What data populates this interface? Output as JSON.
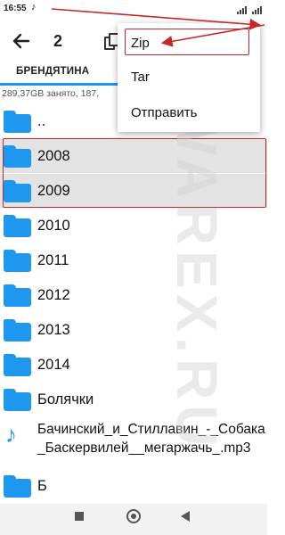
{
  "status_bar": {
    "time": "16:55"
  },
  "toolbar": {
    "selected_count": "2"
  },
  "tab": {
    "label": "БРЕНДЯТИНА"
  },
  "storage_info": "289,37GB занято, 187,",
  "files": [
    {
      "name": "..",
      "type": "folder",
      "selected": false
    },
    {
      "name": "2008",
      "type": "folder",
      "selected": true
    },
    {
      "name": "2009",
      "type": "folder",
      "selected": true
    },
    {
      "name": "2010",
      "type": "folder",
      "selected": false
    },
    {
      "name": "2011",
      "type": "folder",
      "selected": false
    },
    {
      "name": "2012",
      "type": "folder",
      "selected": false
    },
    {
      "name": "2013",
      "type": "folder",
      "selected": false
    },
    {
      "name": "2014",
      "type": "folder",
      "selected": false
    },
    {
      "name": "Болячки",
      "type": "folder",
      "selected": false
    },
    {
      "name": "Бачинский_и_Стиллавин_-_Собака_Баскервилей__мегаржачь_.mp3",
      "type": "audio",
      "selected": false
    },
    {
      "name": "Б",
      "type": "folder",
      "selected": false
    }
  ],
  "context_menu": {
    "items": [
      {
        "label": "Zip"
      },
      {
        "label": "Tar"
      },
      {
        "label": "Отправить"
      }
    ]
  },
  "watermark": "WAREX.RU",
  "colors": {
    "folder": "#1e98ee",
    "tab_indicator": "#2196f3",
    "annotation": "#c62828",
    "selection_bg": "#e3e3e3"
  }
}
